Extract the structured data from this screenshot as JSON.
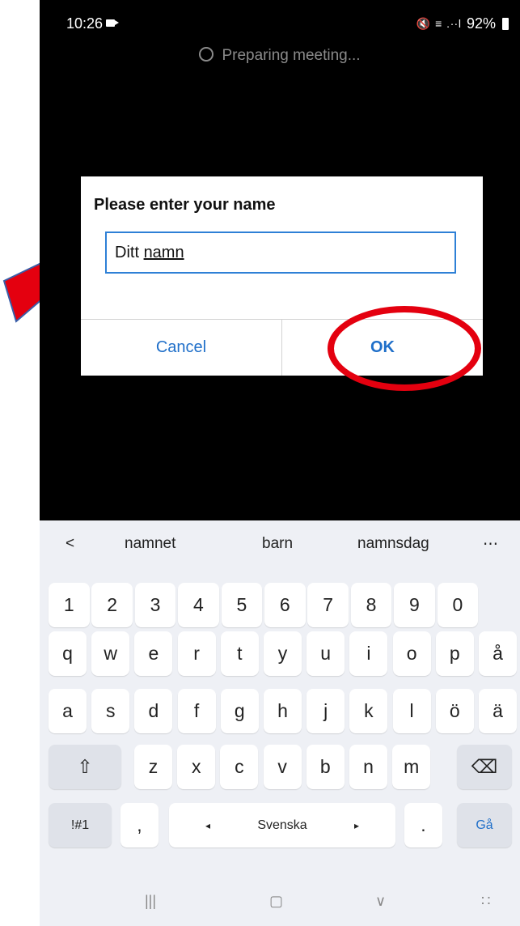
{
  "status": {
    "time": "10:26",
    "signal": "🔇 ≡ .∙∙l",
    "battery": "92%"
  },
  "loading": {
    "text": "Preparing meeting..."
  },
  "dialog": {
    "title": "Please enter your name",
    "input_prefix": "Ditt ",
    "input_underlined": "namn",
    "cancel_label": "Cancel",
    "ok_label": "OK"
  },
  "suggestions": {
    "back": "<",
    "items": [
      "namnet",
      "barn",
      "namnsdag"
    ],
    "more": "⋯"
  },
  "keyboard": {
    "numbers": [
      "1",
      "2",
      "3",
      "4",
      "5",
      "6",
      "7",
      "8",
      "9",
      "0"
    ],
    "row1": [
      "q",
      "w",
      "e",
      "r",
      "t",
      "y",
      "u",
      "i",
      "o",
      "p",
      "å"
    ],
    "row2": [
      "a",
      "s",
      "d",
      "f",
      "g",
      "h",
      "j",
      "k",
      "l",
      "ö",
      "ä"
    ],
    "row3": [
      "z",
      "x",
      "c",
      "v",
      "b",
      "n",
      "m"
    ],
    "shift": "⇧",
    "backspace": "⌫",
    "symbols": "!#1",
    "comma": ",",
    "space_label": "Svenska",
    "left_arrow": "◂",
    "right_arrow": "▸",
    "period": ".",
    "go": "Gå"
  },
  "navbar": {
    "recents": "|||",
    "home": "▢",
    "back": "∨",
    "keyboard": "∷"
  },
  "colors": {
    "accent": "#1f6fc9",
    "highlight": "#e4000f"
  }
}
